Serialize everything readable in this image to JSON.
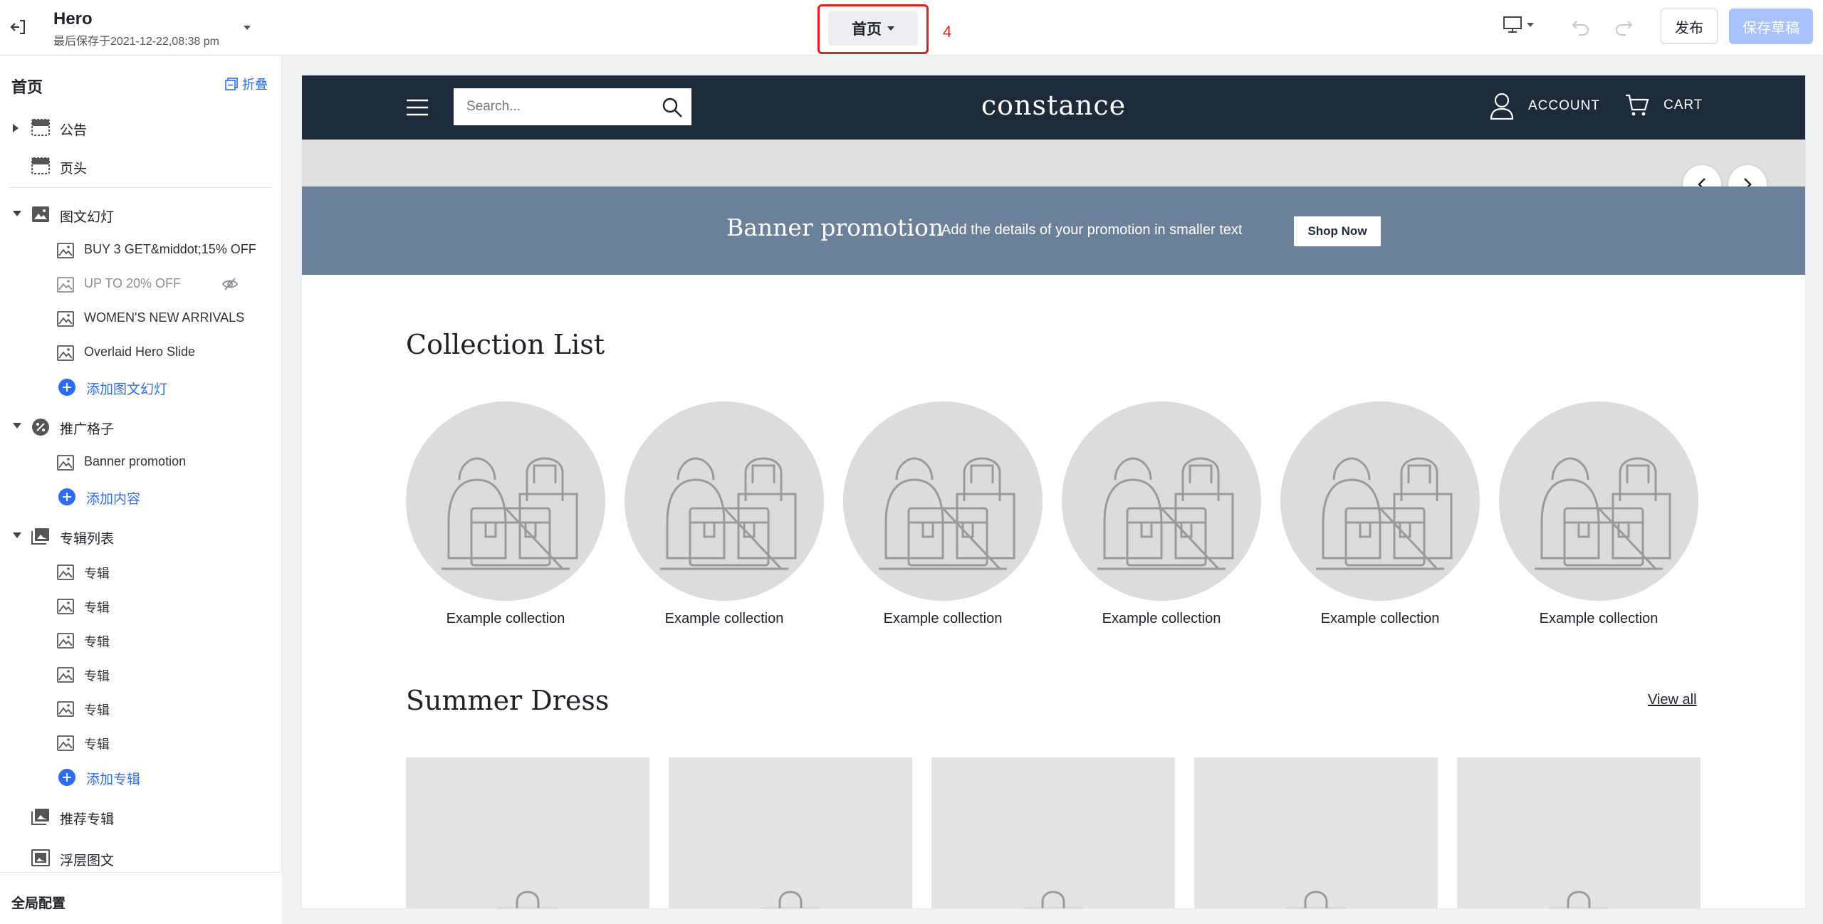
{
  "topbar": {
    "title": "Hero",
    "saved_at": "最后保存于2021-12-22,08:38 pm",
    "page_selector": "首页",
    "annotation": "4",
    "publish_label": "发布",
    "save_draft_label": "保存草稿"
  },
  "sidebar": {
    "header": "首页",
    "collapse_label": "折叠",
    "items": {
      "announcement": "公告",
      "header": "页头",
      "slideshow": "图文幻灯",
      "slide1": "BUY 3 GET&middot;15% OFF",
      "slide2": "UP TO 20% OFF",
      "slide3": "WOMEN'S NEW ARRIVALS",
      "slide4": "Overlaid Hero Slide",
      "add_slide": "添加图文幻灯",
      "promo_grid": "推广格子",
      "banner_promo": "Banner promotion",
      "add_content": "添加内容",
      "collection_list": "专辑列表",
      "collection": "专辑",
      "add_collection": "添加专辑",
      "featured_collection": "推荐专辑",
      "overlay_text": "浮层图文"
    },
    "footer": "全局配置"
  },
  "store": {
    "search_placeholder": "Search...",
    "brand": "constance",
    "account": "ACCOUNT",
    "cart": "CART",
    "banner_title": "Banner promotion",
    "banner_text": "Add the details of your promotion in smaller text",
    "banner_button": "Shop Now",
    "collection_list_title": "Collection List",
    "collection_name": "Example collection",
    "summer_title": "Summer Dress",
    "view_all": "View all"
  },
  "colors": {
    "accent": "#2c6cf6",
    "store_header": "#1c2a3a",
    "banner": "#6b8099",
    "annotation": "#e02020"
  }
}
